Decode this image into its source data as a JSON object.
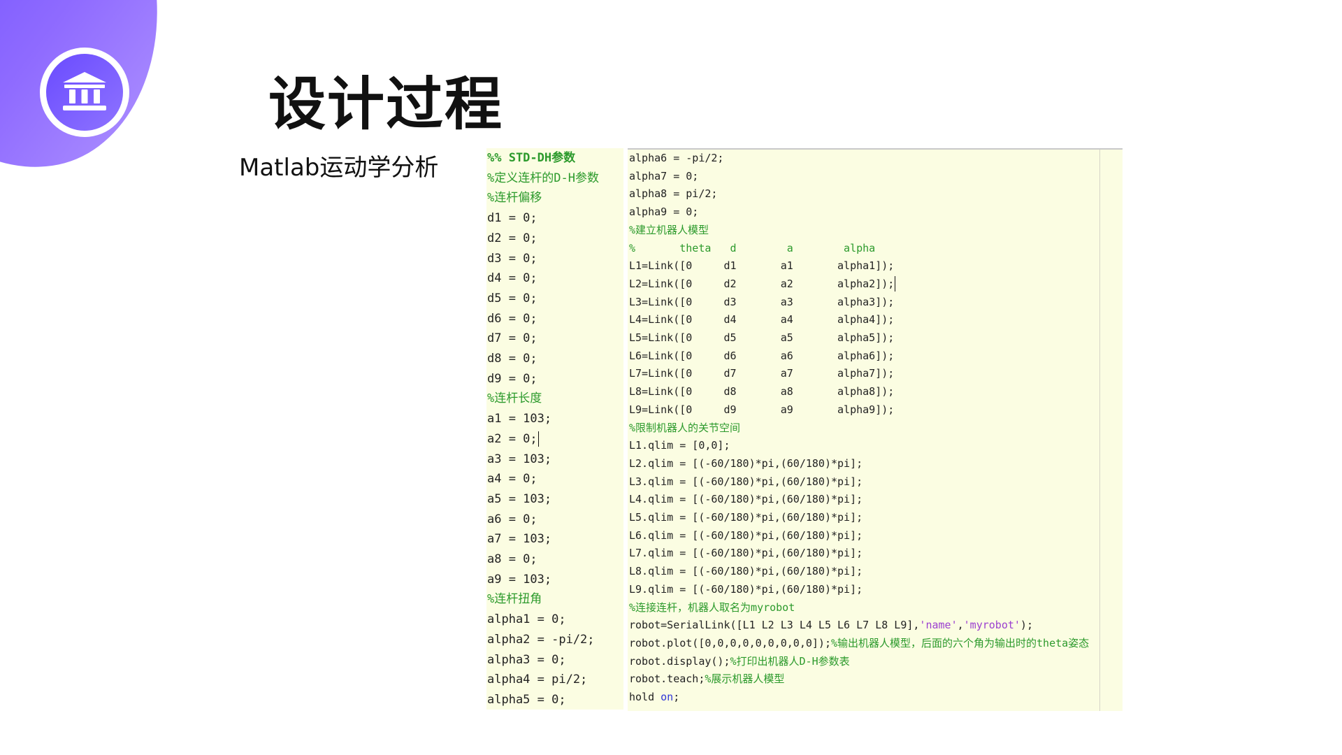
{
  "title": "设计过程",
  "subtitle": "Matlab运动学分析",
  "logo": {
    "icon": "institution-icon",
    "accent": "#6a4bff"
  },
  "code_left": [
    {
      "text": "%% STD-DH参数",
      "kind": "cmt-bold"
    },
    {
      "text": "%定义连杆的D-H参数",
      "kind": "cmt"
    },
    {
      "text": "%连杆偏移",
      "kind": "cmt"
    },
    {
      "text": "d1 = 0;",
      "kind": "code"
    },
    {
      "text": "d2 = 0;",
      "kind": "code"
    },
    {
      "text": "d3 = 0;",
      "kind": "code"
    },
    {
      "text": "d4 = 0;",
      "kind": "code"
    },
    {
      "text": "d5 = 0;",
      "kind": "code"
    },
    {
      "text": "d6 = 0;",
      "kind": "code"
    },
    {
      "text": "d7 = 0;",
      "kind": "code"
    },
    {
      "text": "d8 = 0;",
      "kind": "code"
    },
    {
      "text": "d9 = 0;",
      "kind": "code"
    },
    {
      "text": "%连杆长度",
      "kind": "cmt"
    },
    {
      "text": "a1 = 103;",
      "kind": "code"
    },
    {
      "text": "a2 = 0;",
      "kind": "code",
      "caret": true
    },
    {
      "text": "a3 = 103;",
      "kind": "code"
    },
    {
      "text": "a4 = 0;",
      "kind": "code"
    },
    {
      "text": "a5 = 103;",
      "kind": "code"
    },
    {
      "text": "a6 = 0;",
      "kind": "code"
    },
    {
      "text": "a7 = 103;",
      "kind": "code"
    },
    {
      "text": "a8 = 0;",
      "kind": "code"
    },
    {
      "text": "a9 = 103;",
      "kind": "code"
    },
    {
      "text": "%连杆扭角",
      "kind": "cmt"
    },
    {
      "text": "alpha1 = 0;",
      "kind": "code"
    },
    {
      "text": "alpha2 = -pi/2;",
      "kind": "code"
    },
    {
      "text": "alpha3 = 0;",
      "kind": "code"
    },
    {
      "text": "alpha4 = pi/2;",
      "kind": "code"
    },
    {
      "text": "alpha5 = 0;",
      "kind": "code"
    }
  ],
  "code_right": [
    [
      {
        "t": "alpha6 = -pi/2;",
        "c": "code"
      }
    ],
    [
      {
        "t": "alpha7 = 0;",
        "c": "code"
      }
    ],
    [
      {
        "t": "alpha8 = pi/2;",
        "c": "code"
      }
    ],
    [
      {
        "t": "alpha9 = 0;",
        "c": "code"
      }
    ],
    [
      {
        "t": "%建立机器人模型",
        "c": "cmt"
      }
    ],
    [
      {
        "t": "%       theta   d        a        alpha",
        "c": "cmt"
      }
    ],
    [
      {
        "t": "L1=Link([0     d1       a1       alpha1]);",
        "c": "code"
      }
    ],
    [
      {
        "t": "L2=Link([0     d2       a2       alpha2]);",
        "c": "code",
        "caret": true
      }
    ],
    [
      {
        "t": "L3=Link([0     d3       a3       alpha3]);",
        "c": "code"
      }
    ],
    [
      {
        "t": "L4=Link([0     d4       a4       alpha4]);",
        "c": "code"
      }
    ],
    [
      {
        "t": "L5=Link([0     d5       a5       alpha5]);",
        "c": "code"
      }
    ],
    [
      {
        "t": "L6=Link([0     d6       a6       alpha6]);",
        "c": "code"
      }
    ],
    [
      {
        "t": "L7=Link([0     d7       a7       alpha7]);",
        "c": "code"
      }
    ],
    [
      {
        "t": "L8=Link([0     d8       a8       alpha8]);",
        "c": "code"
      }
    ],
    [
      {
        "t": "L9=Link([0     d9       a9       alpha9]);",
        "c": "code"
      }
    ],
    [
      {
        "t": "%限制机器人的关节空间",
        "c": "cmt"
      }
    ],
    [
      {
        "t": "L1.qlim = [0,0];",
        "c": "code"
      }
    ],
    [
      {
        "t": "L2.qlim = [(-60/180)*pi,(60/180)*pi];",
        "c": "code"
      }
    ],
    [
      {
        "t": "L3.qlim = [(-60/180)*pi,(60/180)*pi];",
        "c": "code"
      }
    ],
    [
      {
        "t": "L4.qlim = [(-60/180)*pi,(60/180)*pi];",
        "c": "code"
      }
    ],
    [
      {
        "t": "L5.qlim = [(-60/180)*pi,(60/180)*pi];",
        "c": "code"
      }
    ],
    [
      {
        "t": "L6.qlim = [(-60/180)*pi,(60/180)*pi];",
        "c": "code"
      }
    ],
    [
      {
        "t": "L7.qlim = [(-60/180)*pi,(60/180)*pi];",
        "c": "code"
      }
    ],
    [
      {
        "t": "L8.qlim = [(-60/180)*pi,(60/180)*pi];",
        "c": "code"
      }
    ],
    [
      {
        "t": "L9.qlim = [(-60/180)*pi,(60/180)*pi];",
        "c": "code"
      }
    ],
    [
      {
        "t": "%连接连杆，机器人取名为myrobot",
        "c": "cmt"
      }
    ],
    [
      {
        "t": "robot=SerialLink([L1 L2 L3 L4 L5 L6 L7 L8 L9],",
        "c": "code"
      },
      {
        "t": "'name'",
        "c": "str"
      },
      {
        "t": ",",
        "c": "code"
      },
      {
        "t": "'myrobot'",
        "c": "str"
      },
      {
        "t": ");",
        "c": "code"
      }
    ],
    [
      {
        "t": "robot.plot([0,0,0,0,0,0,0,0,0]);",
        "c": "code"
      },
      {
        "t": "%输出机器人模型，后面的六个角为输出时的theta姿态",
        "c": "cmt"
      }
    ],
    [
      {
        "t": "robot.display();",
        "c": "code"
      },
      {
        "t": "%打印出机器人D-H参数表",
        "c": "cmt"
      }
    ],
    [
      {
        "t": "robot.teach;",
        "c": "code"
      },
      {
        "t": "%展示机器人模型",
        "c": "cmt"
      }
    ],
    [
      {
        "t": "hold ",
        "c": "code"
      },
      {
        "t": "on",
        "c": "kw"
      },
      {
        "t": ";",
        "c": "code"
      }
    ]
  ]
}
